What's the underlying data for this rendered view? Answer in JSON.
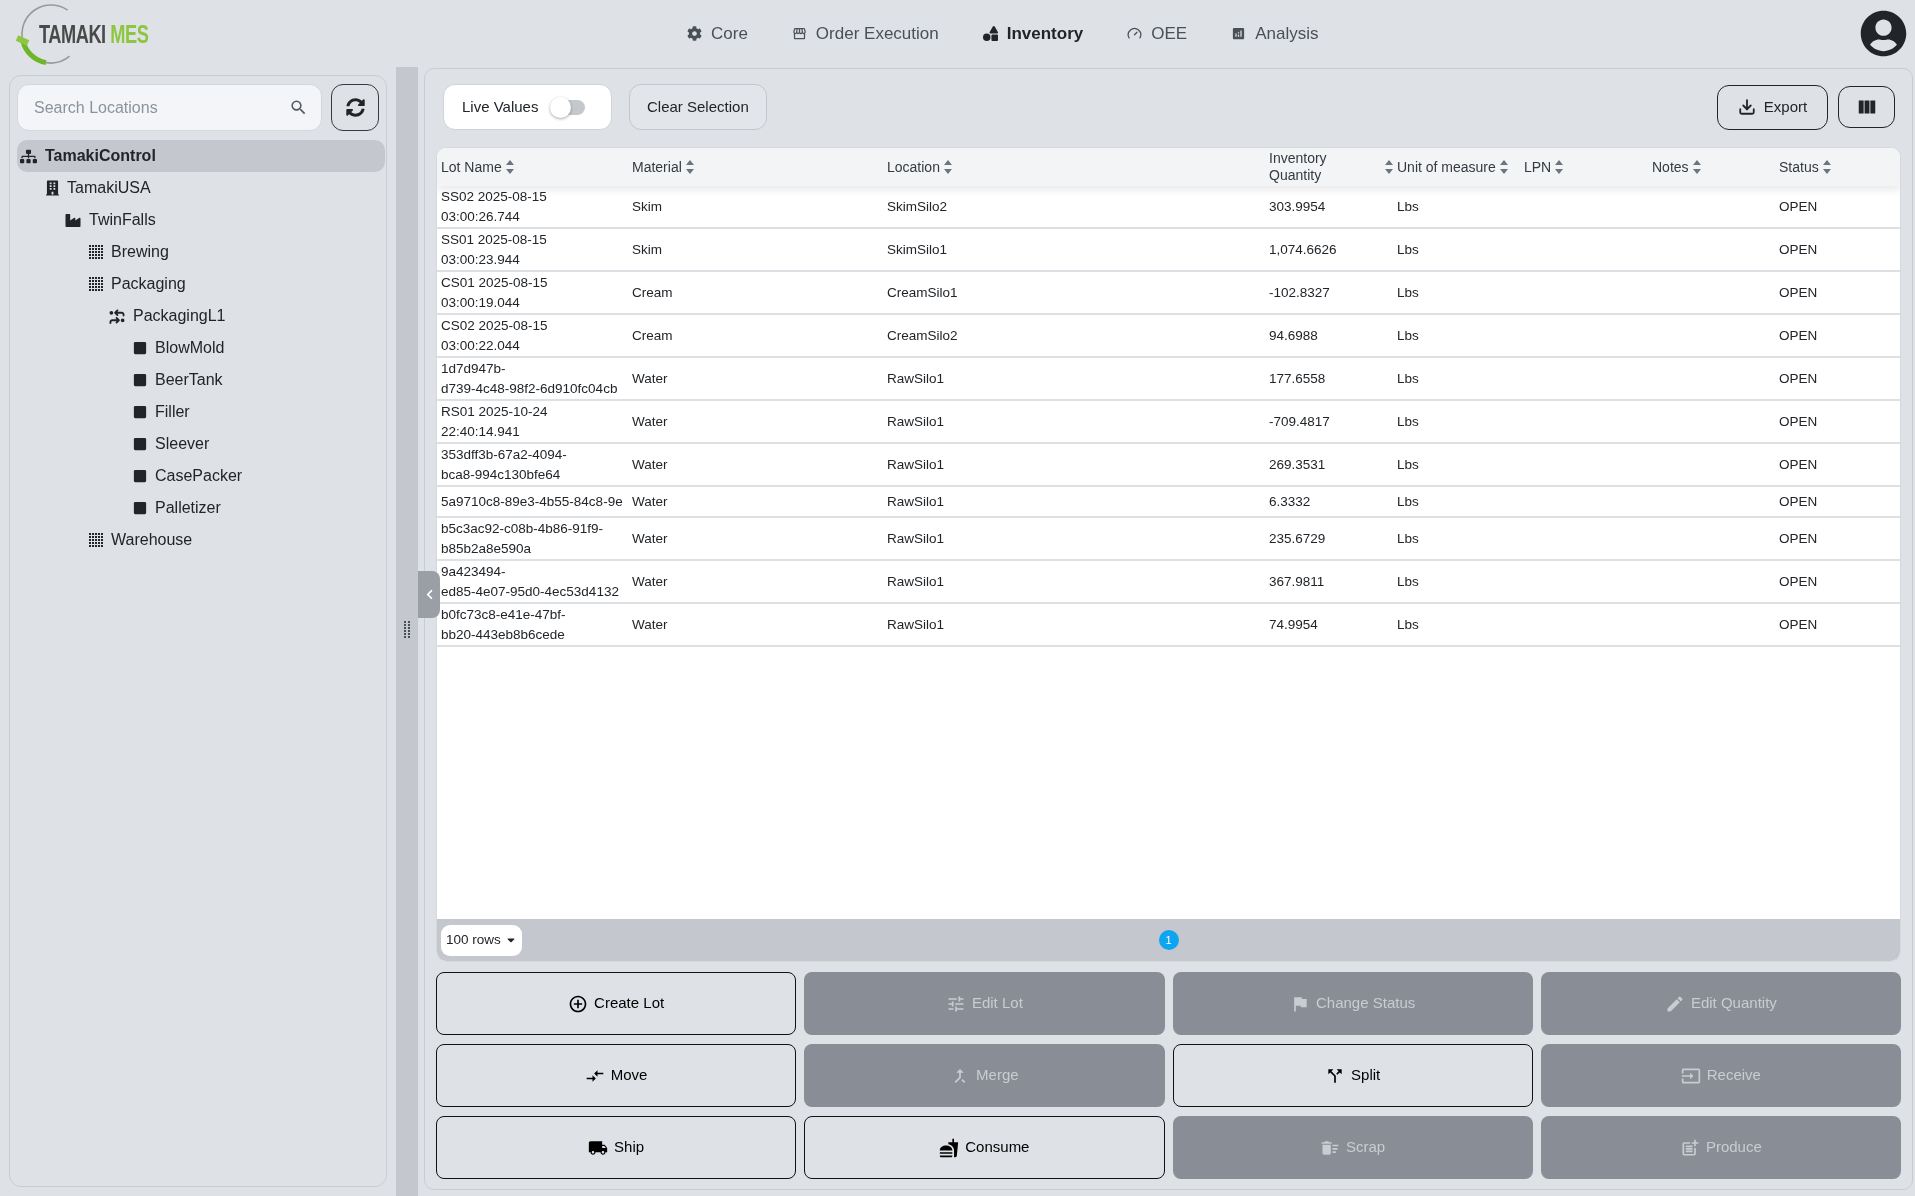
{
  "header": {
    "logo": {
      "text": "TAMAKI",
      "accent": "MES"
    },
    "nav": [
      {
        "label": "Core",
        "kind": "gear",
        "selected": false
      },
      {
        "label": "Order Execution",
        "kind": "store",
        "selected": false
      },
      {
        "label": "Inventory",
        "kind": "shapes",
        "selected": true
      },
      {
        "label": "OEE",
        "kind": "gauge",
        "selected": false
      },
      {
        "label": "Analysis",
        "kind": "chart",
        "selected": false
      }
    ]
  },
  "sidebar": {
    "search": {
      "placeholder": "Search Locations"
    },
    "tree": [
      {
        "label": "TamakiControl",
        "kind": "enterprise",
        "selected": true,
        "children": [
          {
            "label": "TamakiUSA",
            "kind": "site",
            "selected": false,
            "children": [
              {
                "label": "TwinFalls",
                "kind": "plant",
                "selected": false,
                "children": [
                  {
                    "label": "Brewing",
                    "kind": "area",
                    "selected": false
                  },
                  {
                    "label": "Packaging",
                    "kind": "area",
                    "selected": false,
                    "children": [
                      {
                        "label": "PackagingL1",
                        "kind": "line",
                        "selected": false,
                        "children": [
                          {
                            "label": "BlowMold",
                            "kind": "cell",
                            "selected": false
                          },
                          {
                            "label": "BeerTank",
                            "kind": "cell",
                            "selected": false
                          },
                          {
                            "label": "Filler",
                            "kind": "cell",
                            "selected": false
                          },
                          {
                            "label": "Sleever",
                            "kind": "cell",
                            "selected": false
                          },
                          {
                            "label": "CasePacker",
                            "kind": "cell",
                            "selected": false
                          },
                          {
                            "label": "Palletizer",
                            "kind": "cell",
                            "selected": false
                          }
                        ]
                      }
                    ]
                  },
                  {
                    "label": "Warehouse",
                    "kind": "area",
                    "selected": false
                  }
                ]
              }
            ]
          }
        ]
      }
    ]
  },
  "toolbar": {
    "live_values": {
      "label": "Live Values",
      "on": false
    },
    "clear_selection": "Clear Selection",
    "export": "Export"
  },
  "table": {
    "columns": [
      "Lot Name",
      "Material",
      "Location",
      "Inventory Quantity",
      "Unit of measure",
      "LPN",
      "Notes",
      "Status"
    ],
    "rows": [
      {
        "lot_name": "SS02 2025-08-15 03:00:26.744",
        "material": "Skim",
        "location": "SkimSilo2",
        "inventory_quantity": "303.9954",
        "unit_of_measure": "Lbs",
        "status": "OPEN"
      },
      {
        "lot_name": "SS01 2025-08-15 03:00:23.944",
        "material": "Skim",
        "location": "SkimSilo1",
        "inventory_quantity": "1,074.6626",
        "unit_of_measure": "Lbs",
        "status": "OPEN"
      },
      {
        "lot_name": "CS01 2025-08-15 03:00:19.044",
        "material": "Cream",
        "location": "CreamSilo1",
        "inventory_quantity": "-102.8327",
        "unit_of_measure": "Lbs",
        "status": "OPEN"
      },
      {
        "lot_name": "CS02 2025-08-15 03:00:22.044",
        "material": "Cream",
        "location": "CreamSilo2",
        "inventory_quantity": "94.6988",
        "unit_of_measure": "Lbs",
        "status": "OPEN"
      },
      {
        "lot_name": "1d7d947b-d739-4c48-98f2-6d910fc04cb",
        "material": "Water",
        "location": "RawSilo1",
        "inventory_quantity": "177.6558",
        "unit_of_measure": "Lbs",
        "status": "OPEN"
      },
      {
        "lot_name": "RS01 2025-10-24 22:40:14.941",
        "material": "Water",
        "location": "RawSilo1",
        "inventory_quantity": "-709.4817",
        "unit_of_measure": "Lbs",
        "status": "OPEN"
      },
      {
        "lot_name": "353dff3b-67a2-4094-bca8-994c130bfe64",
        "material": "Water",
        "location": "RawSilo1",
        "inventory_quantity": "269.3531",
        "unit_of_measure": "Lbs",
        "status": "OPEN"
      },
      {
        "lot_name": "5a9710c8-89e3-4b55-84c8-9e",
        "material": "Water",
        "location": "RawSilo1",
        "inventory_quantity": "6.3332",
        "unit_of_measure": "Lbs",
        "status": "OPEN"
      },
      {
        "lot_name": "b5c3ac92-c08b-4b86-91f9-b85b2a8e590a",
        "material": "Water",
        "location": "RawSilo1",
        "inventory_quantity": "235.6729",
        "unit_of_measure": "Lbs",
        "status": "OPEN"
      },
      {
        "lot_name": "9a423494-ed85-4e07-95d0-4ec53d4132",
        "material": "Water",
        "location": "RawSilo1",
        "inventory_quantity": "367.9811",
        "unit_of_measure": "Lbs",
        "status": "OPEN"
      },
      {
        "lot_name": "b0fc73c8-e41e-47bf-bb20-443eb8b6cede",
        "material": "Water",
        "location": "RawSilo1",
        "inventory_quantity": "74.9954",
        "unit_of_measure": "Lbs",
        "status": "OPEN"
      }
    ],
    "pagination": {
      "rows_per_page": "100 rows",
      "pages": [
        {
          "label": "1",
          "selected": true
        }
      ]
    }
  },
  "actions": [
    {
      "label": "Create Lot",
      "kind": "create",
      "disabled": false
    },
    {
      "label": "Edit Lot",
      "kind": "edit",
      "disabled": true
    },
    {
      "label": "Change Status",
      "kind": "status",
      "disabled": true
    },
    {
      "label": "Edit Quantity",
      "kind": "quantity",
      "disabled": true
    },
    {
      "label": "Move",
      "kind": "move",
      "disabled": false
    },
    {
      "label": "Merge",
      "kind": "merge",
      "disabled": true
    },
    {
      "label": "Split",
      "kind": "split",
      "disabled": false
    },
    {
      "label": "Receive",
      "kind": "receive",
      "disabled": true
    },
    {
      "label": "Ship",
      "kind": "ship",
      "disabled": false
    },
    {
      "label": "Consume",
      "kind": "consume",
      "disabled": false
    },
    {
      "label": "Scrap",
      "kind": "scrap",
      "disabled": true
    },
    {
      "label": "Produce",
      "kind": "produce",
      "disabled": true
    }
  ]
}
